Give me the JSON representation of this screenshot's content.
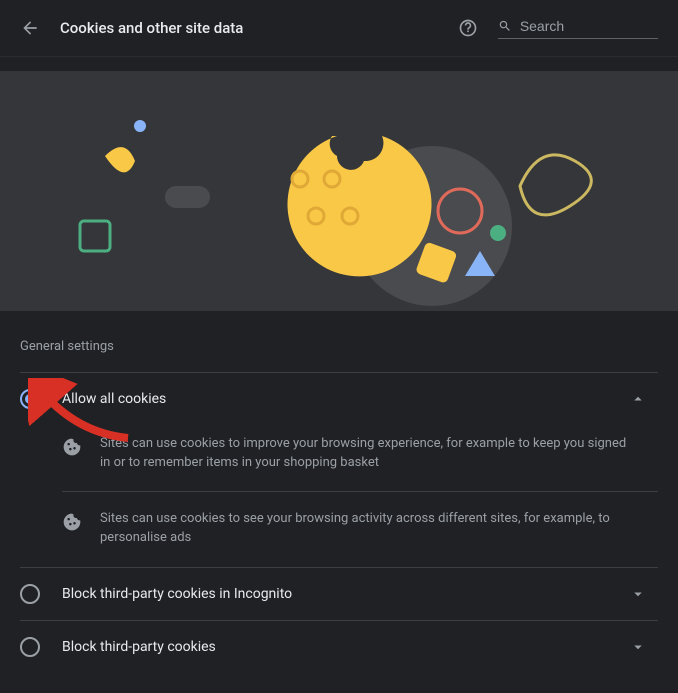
{
  "header": {
    "title": "Cookies and other site data",
    "search_placeholder": "Search"
  },
  "section_label": "General settings",
  "options": {
    "opt0": {
      "label": "Allow all cookies"
    },
    "opt1": {
      "label": "Block third-party cookies in Incognito"
    },
    "opt2": {
      "label": "Block third-party cookies"
    }
  },
  "descriptions": {
    "d0": "Sites can use cookies to improve your browsing experience, for example to keep you signed in or to remember items in your shopping basket",
    "d1": "Sites can use cookies to see your browsing activity across different sites, for example, to personalise ads"
  }
}
